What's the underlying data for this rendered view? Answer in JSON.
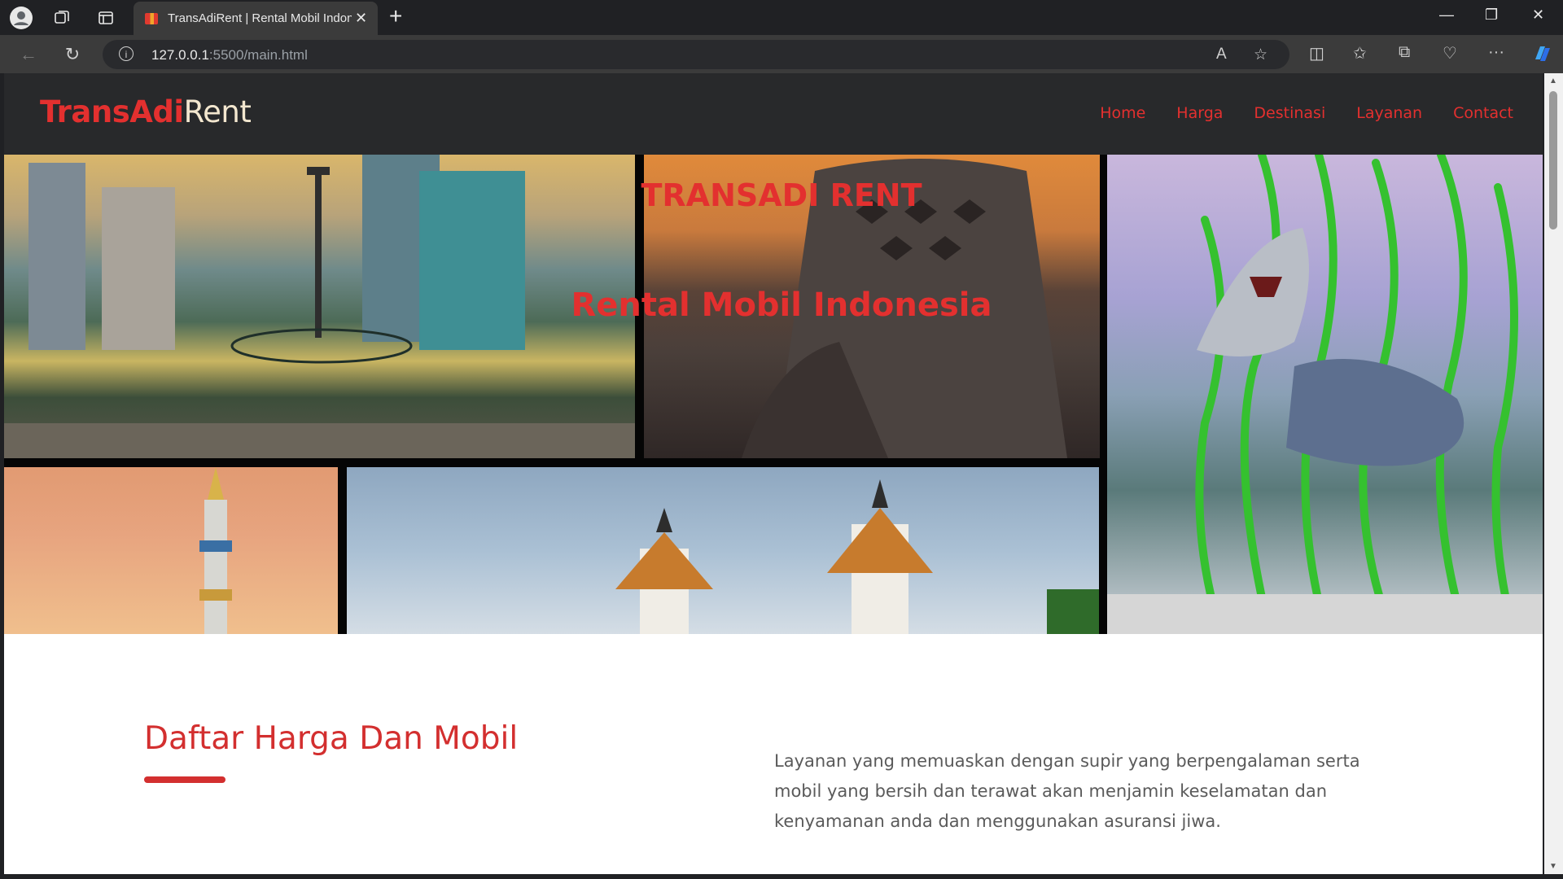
{
  "browser": {
    "tab_title": "TransAdiRent | Rental Mobil Indonesia",
    "tab_close": "✕",
    "new_tab": "+",
    "url_host": "127.0.0.1",
    "url_rest": ":5500/main.html",
    "window_controls": {
      "minimize": "—",
      "restore": "❐",
      "close": "✕"
    }
  },
  "site": {
    "logo_part1": "TransAdi",
    "logo_part2": "Rent",
    "nav": [
      "Home",
      "Harga",
      "Destinasi",
      "Layanan",
      "Contact"
    ]
  },
  "hero": {
    "title": "TRANSADI RENT",
    "subtitle": "Rental Mobil Indonesia"
  },
  "section": {
    "title": "Daftar Harga Dan Mobil",
    "description": "Layanan yang memuaskan dengan supir yang berpengalaman serta mobil yang bersih dan terawat akan menjamin keselamatan dan kenyamanan anda dan menggunakan asuransi jiwa."
  },
  "colors": {
    "accent": "#e3302f",
    "header_bg": "#28292b",
    "logo_secondary": "#f3e7cf"
  }
}
